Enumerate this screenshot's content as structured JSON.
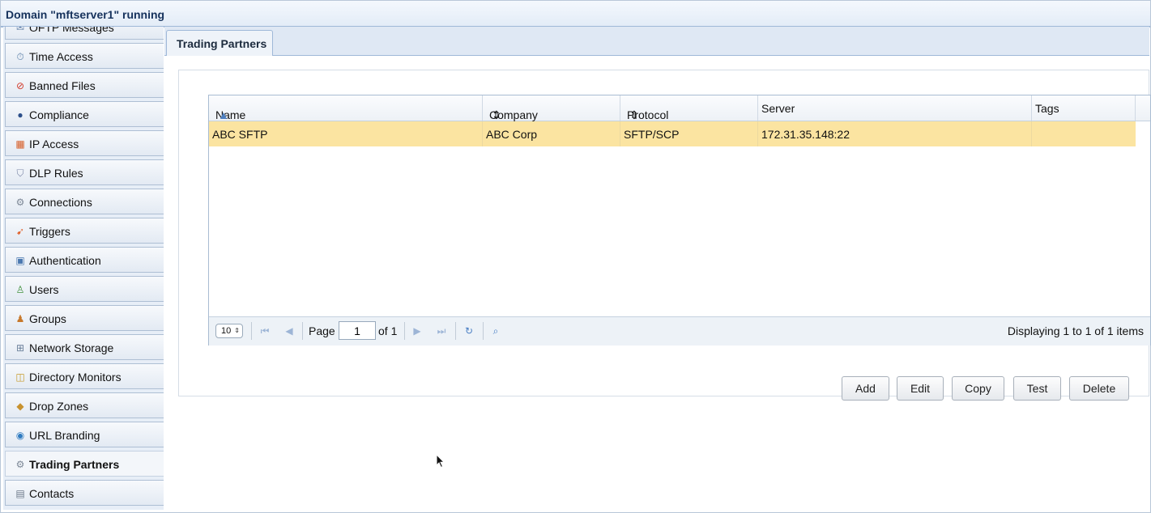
{
  "window": {
    "title": "Domain \"mftserver1\" running"
  },
  "sidebar": {
    "items": [
      {
        "label": "OFTP Messages",
        "icon": "message-icon"
      },
      {
        "label": "Time Access",
        "icon": "clock-icon"
      },
      {
        "label": "Banned Files",
        "icon": "banned-file-icon"
      },
      {
        "label": "Compliance",
        "icon": "compliance-user-icon"
      },
      {
        "label": "IP Access",
        "icon": "firewall-icon"
      },
      {
        "label": "DLP Rules",
        "icon": "shield-icon"
      },
      {
        "label": "Connections",
        "icon": "gear-icon"
      },
      {
        "label": "Triggers",
        "icon": "trigger-icon"
      },
      {
        "label": "Authentication",
        "icon": "authentication-icon"
      },
      {
        "label": "Users",
        "icon": "user-icon"
      },
      {
        "label": "Groups",
        "icon": "group-icon"
      },
      {
        "label": "Network Storage",
        "icon": "network-storage-icon"
      },
      {
        "label": "Directory Monitors",
        "icon": "directory-monitor-icon"
      },
      {
        "label": "Drop Zones",
        "icon": "box-icon"
      },
      {
        "label": "URL Branding",
        "icon": "globe-icon"
      },
      {
        "label": "Trading Partners",
        "icon": "gear-icon"
      },
      {
        "label": "Contacts",
        "icon": "contacts-book-icon"
      }
    ],
    "active": "Trading Partners"
  },
  "main": {
    "tab": {
      "label": "Trading Partners"
    },
    "grid": {
      "columns": [
        {
          "label": "Name",
          "sort": "asc"
        },
        {
          "label": "Company",
          "sort": "sortable"
        },
        {
          "label": "Protocol",
          "sort": "sortable"
        },
        {
          "label": "Server",
          "sort": "none"
        },
        {
          "label": "Tags",
          "sort": "none"
        }
      ],
      "rows": [
        {
          "name": "ABC SFTP",
          "company": "ABC Corp",
          "protocol": "SFTP/SCP",
          "server": "172.31.35.148:22",
          "tags": ""
        }
      ]
    },
    "pager": {
      "page_size": "10",
      "page_label": "Page",
      "page_value": "1",
      "of_label": "of 1",
      "info": "Displaying 1 to 1 of 1 items"
    },
    "buttons": {
      "add": "Add",
      "edit": "Edit",
      "copy": "Copy",
      "test": "Test",
      "delete": "Delete"
    }
  },
  "colors": {
    "selected_row": "#fbe4a1",
    "header_blue": "#dfe8f4",
    "border_blue": "#9fb8d8"
  }
}
